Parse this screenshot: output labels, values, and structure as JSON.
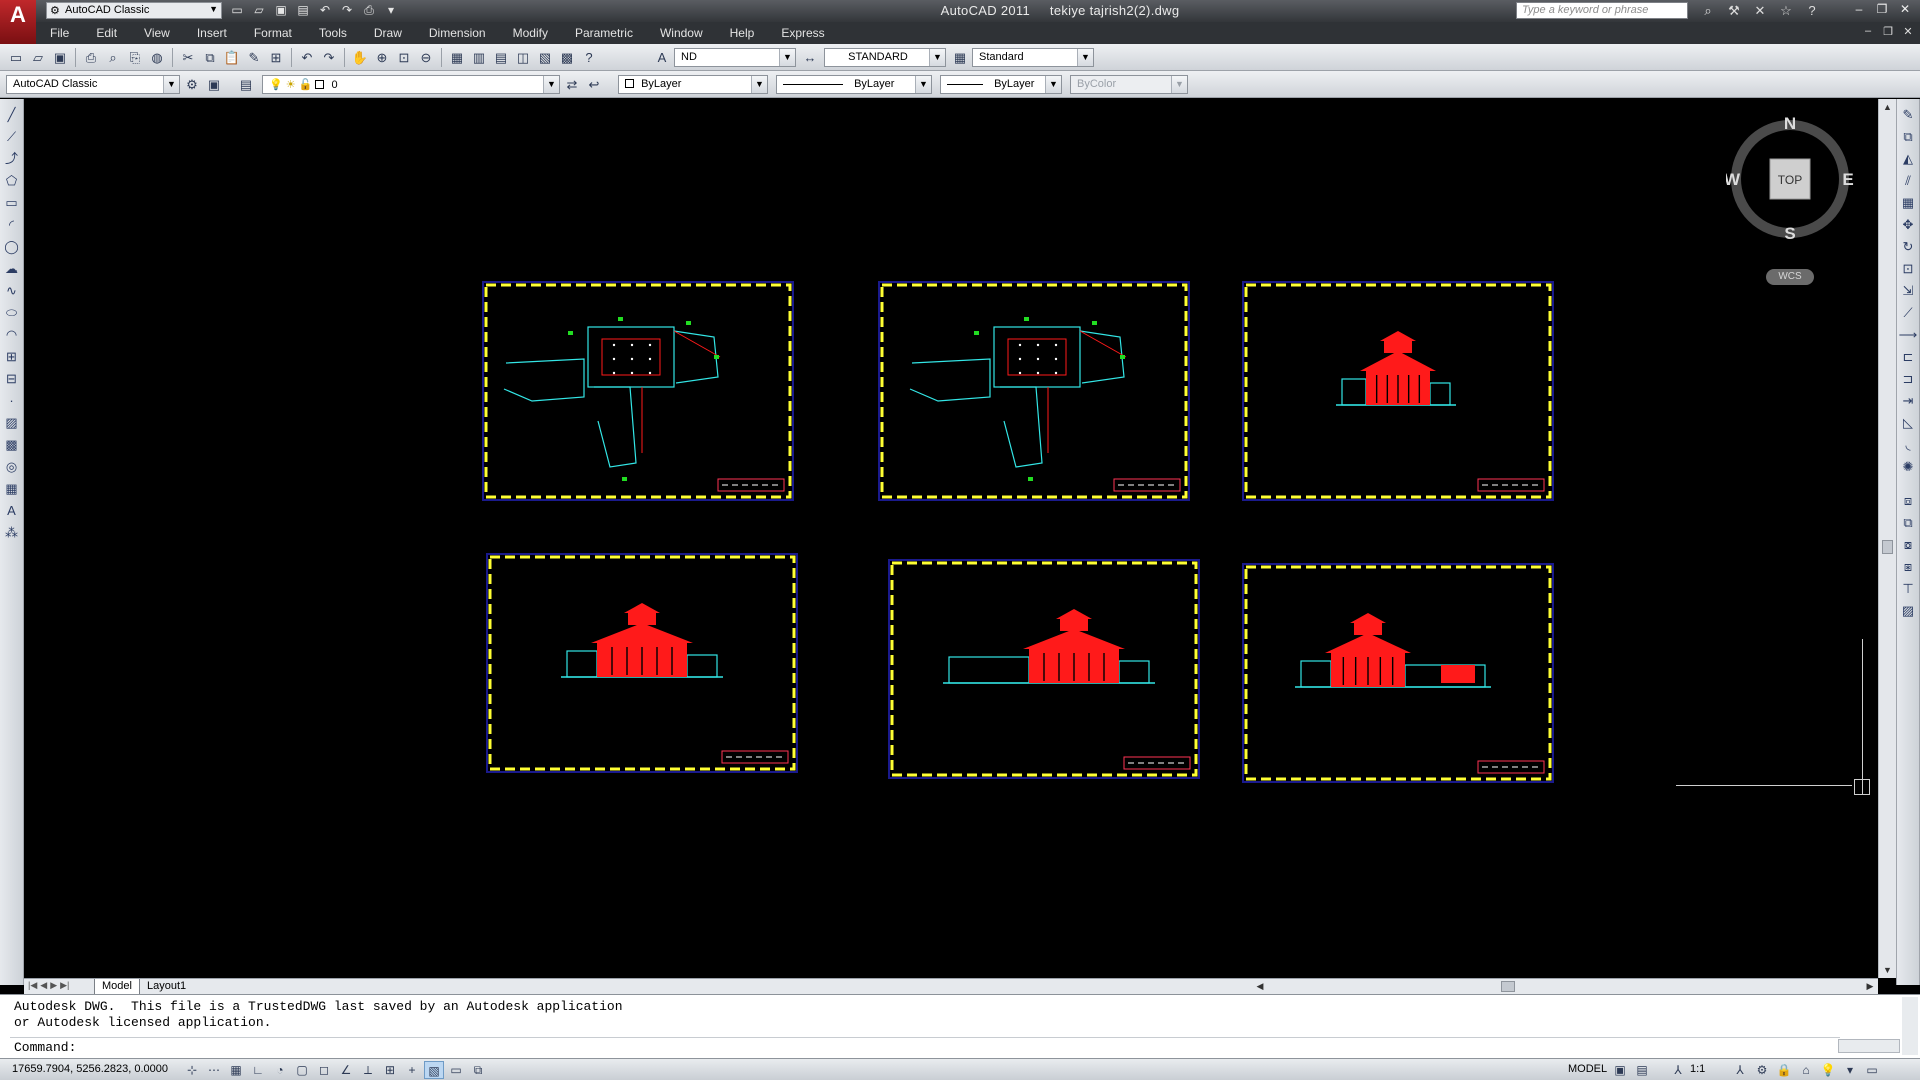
{
  "app": {
    "workspace": "AutoCAD Classic",
    "title_app": "AutoCAD 2011",
    "title_file": "tekiye tajrish2(2).dwg",
    "search_placeholder": "Type a keyword or phrase"
  },
  "menu": [
    "File",
    "Edit",
    "View",
    "Insert",
    "Format",
    "Tools",
    "Draw",
    "Dimension",
    "Modify",
    "Parametric",
    "Window",
    "Help",
    "Express"
  ],
  "styles_toolbar": {
    "text_style": "ND",
    "dim_style": "STANDARD",
    "table_style": "Standard"
  },
  "layers_toolbar": {
    "workspace": "AutoCAD Classic",
    "layer": "0",
    "color": "ByLayer",
    "linetype": "ByLayer",
    "lineweight": "ByLayer",
    "plot_style": "ByColor"
  },
  "viewcube": {
    "north": "N",
    "south": "S",
    "east": "E",
    "west": "W",
    "face": "TOP",
    "ucs": "WCS"
  },
  "tabs": [
    "Model",
    "Layout1"
  ],
  "active_tab": "Model",
  "command": {
    "history_1": "Autodesk DWG.  This file is a TrustedDWG last saved by an Autodesk application",
    "history_2": "or Autodesk licensed application.",
    "prompt": "Command:"
  },
  "status": {
    "coordinates": "17659.7904, 5256.2823, 0.0000",
    "space": "MODEL",
    "annotation_scale": "1:1"
  },
  "colors": {
    "sheet_border": "#ffff33",
    "sheet_frame": "#1a1a8c",
    "plan_lines": "#33e6e6",
    "elevation": "#ff1a1a",
    "accent_green": "#22dd22"
  },
  "sheets": [
    {
      "kind": "plan",
      "variant": 1
    },
    {
      "kind": "plan",
      "variant": 2
    },
    {
      "kind": "elevation",
      "variant": "small"
    },
    {
      "kind": "elevation",
      "variant": "front"
    },
    {
      "kind": "elevation",
      "variant": "long-left"
    },
    {
      "kind": "elevation",
      "variant": "long-right"
    }
  ]
}
